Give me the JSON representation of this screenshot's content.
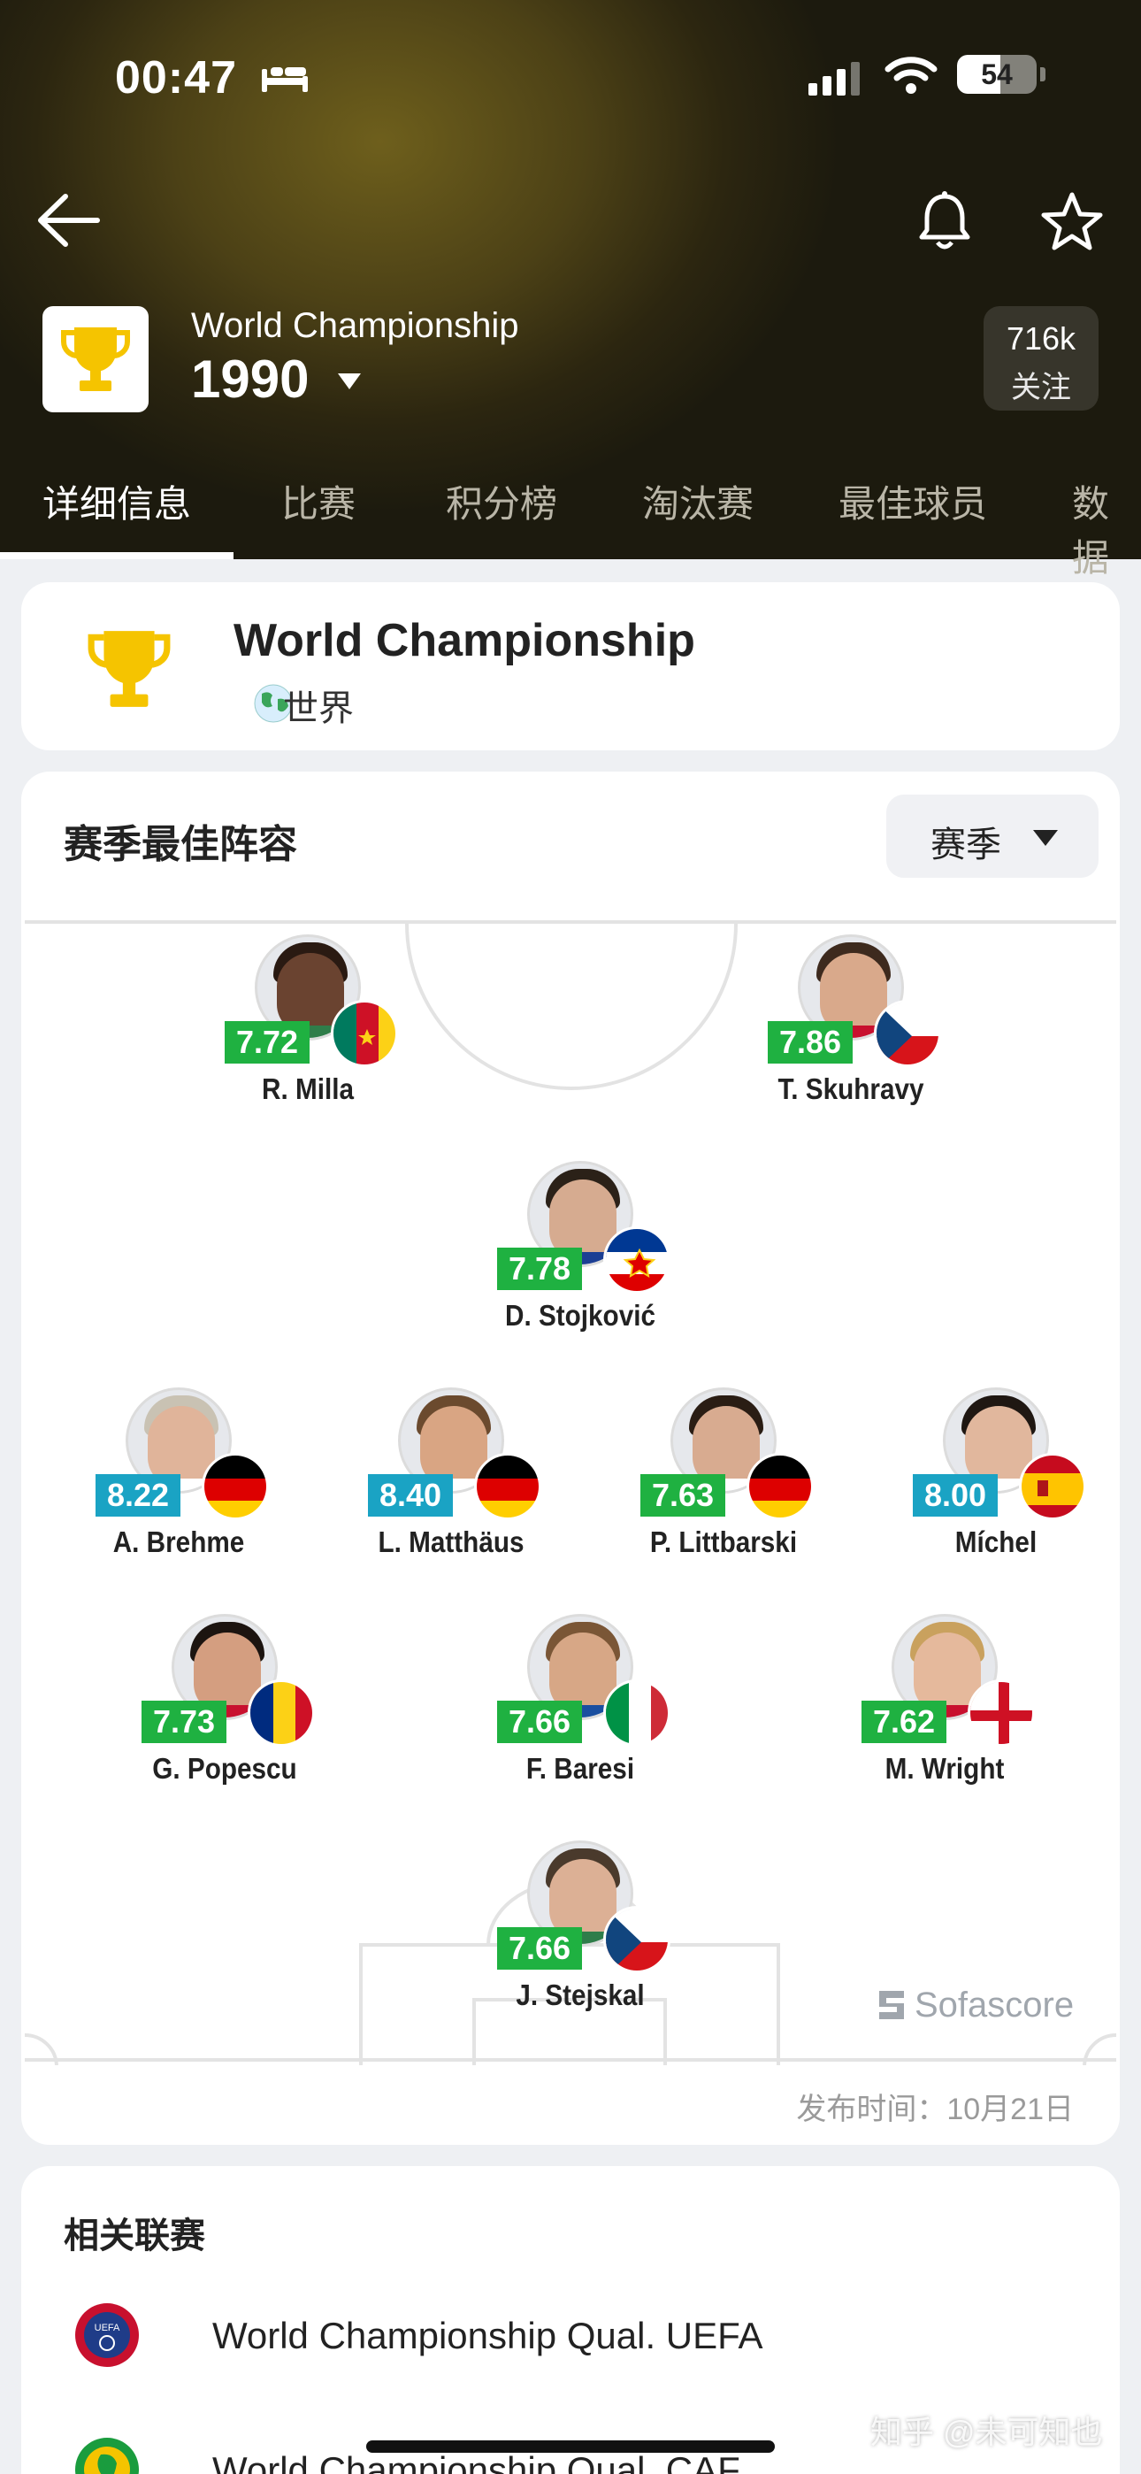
{
  "status_bar": {
    "time": "00:47",
    "battery": "54"
  },
  "header": {
    "competition": "World Championship",
    "season": "1990",
    "followers": "716k",
    "follow_label": "关注"
  },
  "tabs": [
    "详细信息",
    "比赛",
    "积分榜",
    "淘汰赛",
    "最佳球员",
    "数据"
  ],
  "info": {
    "title": "World Championship",
    "country": "世界"
  },
  "team_of_season": {
    "title": "赛季最佳阵容",
    "selector": "赛季",
    "publish_time": "发布时间：10月21日",
    "brand": "Sofascore",
    "players": [
      {
        "name": "R. Milla",
        "rating": "7.72",
        "rating_color": "#1fb141",
        "flag": "cameroon"
      },
      {
        "name": "T. Skuhravy",
        "rating": "7.86",
        "rating_color": "#1fb141",
        "flag": "czechoslovakia"
      },
      {
        "name": "D. Stojković",
        "rating": "7.78",
        "rating_color": "#1fb141",
        "flag": "yugoslavia"
      },
      {
        "name": "A. Brehme",
        "rating": "8.22",
        "rating_color": "#1aa3c4",
        "flag": "germany"
      },
      {
        "name": "L. Matthäus",
        "rating": "8.40",
        "rating_color": "#1aa3c4",
        "flag": "germany"
      },
      {
        "name": "P. Littbarski",
        "rating": "7.63",
        "rating_color": "#1fb141",
        "flag": "germany"
      },
      {
        "name": "Míchel",
        "rating": "8.00",
        "rating_color": "#1aa3c4",
        "flag": "spain"
      },
      {
        "name": "G. Popescu",
        "rating": "7.73",
        "rating_color": "#1fb141",
        "flag": "romania"
      },
      {
        "name": "F. Baresi",
        "rating": "7.66",
        "rating_color": "#1fb141",
        "flag": "italy"
      },
      {
        "name": "M. Wright",
        "rating": "7.62",
        "rating_color": "#1fb141",
        "flag": "england"
      },
      {
        "name": "J. Stejskal",
        "rating": "7.66",
        "rating_color": "#1fb141",
        "flag": "czechoslovakia"
      }
    ]
  },
  "related": {
    "title": "相关联赛",
    "items": [
      {
        "label": "World Championship Qual. UEFA",
        "icon": "uefa-logo-icon"
      },
      {
        "label": "World Championship Qual. CAF",
        "icon": "caf-logo-icon"
      }
    ]
  },
  "watermark": "知乎 @未可知也",
  "colors": {
    "accent_gold": "#f5c400",
    "rating_green": "#1fb141",
    "rating_blue": "#1aa3c4"
  }
}
